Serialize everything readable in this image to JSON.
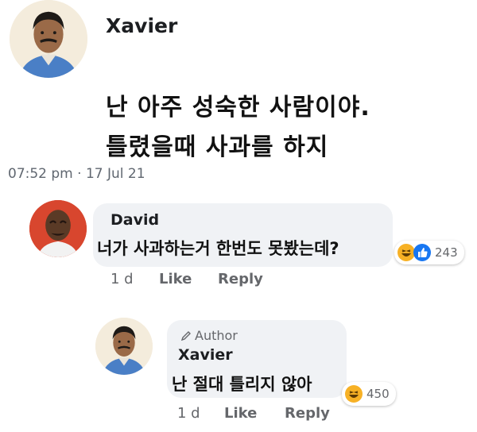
{
  "post": {
    "author": "Xavier",
    "line1": "난 아주 성숙한 사람이야.",
    "line2": "틀렸을때 사과를 하지",
    "timestamp": "07:52 pm · 17 Jul 21"
  },
  "comments": [
    {
      "name": "David",
      "text": "너가 사과하는거 한번도 못봤는데?",
      "time": "1 d",
      "like_label": "Like",
      "reply_label": "Reply",
      "reaction_count": "243",
      "reactions": [
        "haha-icon",
        "like-icon"
      ]
    },
    {
      "badge": "Author",
      "name": "Xavier",
      "text": "난 절대 틀리지 않아",
      "time": "1 d",
      "like_label": "Like",
      "reply_label": "Reply",
      "reaction_count": "450",
      "reactions": [
        "haha-icon"
      ]
    }
  ],
  "colors": {
    "bubble": "#f0f2f5",
    "like_blue": "#1877f2",
    "haha_yellow": "#f7b125",
    "meta_gray": "#65676b"
  }
}
